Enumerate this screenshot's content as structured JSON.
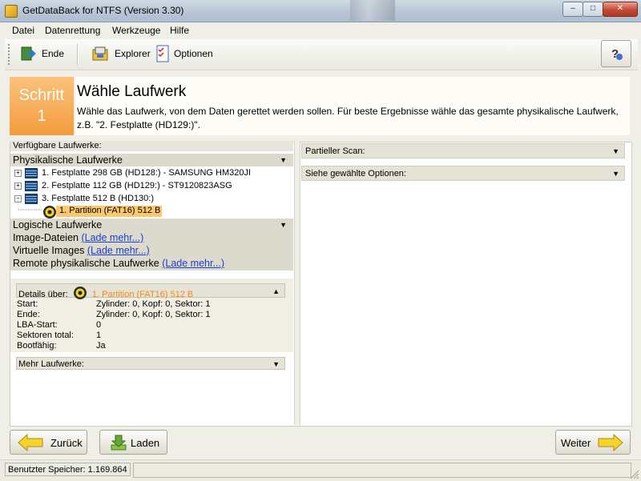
{
  "window": {
    "title": "GetDataBack for NTFS (Version 3.30)",
    "controls": {
      "minimize": "–",
      "maximize": "□",
      "close": "✕"
    }
  },
  "menu": [
    {
      "label": "Datei"
    },
    {
      "label": "Datenrettung"
    },
    {
      "label": "Werkzeuge"
    },
    {
      "label": "Hilfe"
    }
  ],
  "toolbar": {
    "exit_label": "Ende",
    "explorer_label": "Explorer",
    "options_label": "Optionen",
    "help_icon": "help-question-icon"
  },
  "step": {
    "word": "Schritt",
    "number": "1",
    "title": "Wähle Laufwerk",
    "description": "Wähle das Laufwerk, von dem Daten gerettet werden sollen. Für beste Ergebnisse wähle das gesamte physikalische Laufwerk, z.B. \"2. Festplatte (HD129:)\"."
  },
  "drives": {
    "header": "Verfügbare Laufwerke:",
    "physical": {
      "label": "Physikalische Laufwerke",
      "items": [
        {
          "label": "1. Festplatte 298 GB (HD128:) - SAMSUNG HM320JI",
          "expander": "+"
        },
        {
          "label": "2. Festplatte 112 GB (HD129:) - ST9120823ASG",
          "expander": "+"
        },
        {
          "label": "3. Festplatte 512 B (HD130:)",
          "expander": "−"
        }
      ],
      "selected_partition": "1. Partition (FAT16) 512 B"
    },
    "logical": {
      "label": "Logische Laufwerke"
    },
    "image_files": {
      "label": "Image-Dateien",
      "link": "(Lade mehr...)"
    },
    "virtual_images": {
      "label": "Virtuelle Images",
      "link": "(Lade mehr...)"
    },
    "remote": {
      "label": "Remote physikalische Laufwerke",
      "link": "(Lade mehr...)"
    }
  },
  "details": {
    "header_label": "Details über:",
    "header_item": "1. Partition (FAT16) 512 B",
    "rows": [
      {
        "key": "Start:",
        "value": "Zylinder: 0, Kopf: 0, Sektor: 1"
      },
      {
        "key": "Ende:",
        "value": "Zylinder: 0, Kopf: 0, Sektor: 1"
      },
      {
        "key": "LBA-Start:",
        "value": "0"
      },
      {
        "key": "Sektoren total:",
        "value": "1"
      },
      {
        "key": "Bootfähig:",
        "value": "Ja"
      }
    ]
  },
  "more_drives": "Mehr Laufwerke:",
  "right": {
    "partial_scan": "Partieller Scan:",
    "selected_options": "Siehe gewählte Optionen:"
  },
  "nav": {
    "back": "Zurück",
    "load": "Laden",
    "next": "Weiter"
  },
  "status": {
    "memory": "Benutzter Speicher: 1.169.864"
  },
  "colors": {
    "step_orange": "#f39c3c",
    "selection": "#fbc86f",
    "link": "#1d3fd0"
  }
}
